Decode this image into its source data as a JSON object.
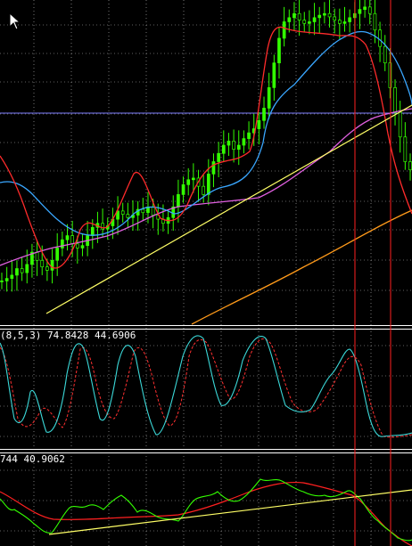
{
  "stochastic_panel": {
    "label": "(8,5,3) 74.8428 44.6906"
  },
  "oscillator_panel": {
    "label": "744 40.9062"
  },
  "cursor": {
    "icon": "mouse-pointer-icon"
  },
  "colors": {
    "background": "#000000",
    "grid": "#c0c0c0",
    "price": "#33ff00",
    "ma_fast": "#ff2b2b",
    "ma_mid": "#3aa7ff",
    "ma_slow": "#e060e0",
    "ma_long": "#ff9a1a",
    "trendline": "#ffff66",
    "hline": "#8080ff",
    "vlines": "#ff1f1f",
    "stoch_main": "#3bd8d8",
    "stoch_signal": "#ff3030",
    "osc_main": "#33ff00",
    "osc_signal": "#ff2020"
  },
  "chart_data": {
    "type": "line",
    "series": [
      {
        "values": [
          5,
          8,
          12,
          20,
          15,
          25,
          40,
          30,
          22,
          18,
          30,
          45,
          55,
          60,
          50,
          45,
          48,
          60,
          70,
          75,
          68,
          72,
          80,
          90,
          86,
          82,
          85,
          92,
          88,
          95,
          85,
          80,
          75,
          82,
          95,
          110,
          122,
          128,
          130,
          120,
          110,
          135,
          150,
          160,
          170,
          175,
          165,
          170,
          178,
          185,
          190,
          200,
          215,
          240,
          270,
          300,
          320,
          325,
          330,
          322,
          318,
          320,
          325,
          328,
          330,
          326,
          322,
          318,
          320,
          325,
          330,
          335,
          338,
          330,
          310,
          290,
          270,
          240,
          210,
          180,
          150,
          140
        ]
      },
      {
        "values": [
          30,
          35,
          42,
          50,
          55,
          60,
          62,
          65,
          68,
          70,
          72,
          75,
          78,
          80,
          80,
          82,
          84,
          86,
          88,
          90,
          93,
          96,
          100,
          105,
          110,
          115,
          120,
          125,
          130,
          135,
          140,
          145,
          150,
          155,
          160,
          165,
          170,
          175,
          180,
          185,
          190,
          195,
          200,
          205,
          212,
          220,
          228,
          235,
          242,
          250,
          258,
          265,
          272,
          280,
          288,
          296,
          304,
          312,
          318,
          325,
          330,
          334,
          338,
          340,
          338,
          334,
          330,
          325,
          320,
          312,
          300,
          290
        ]
      },
      {
        "values": [
          10,
          12,
          14,
          16,
          18,
          20,
          22,
          24,
          26,
          28,
          30,
          33,
          36,
          40,
          44,
          48,
          52,
          56,
          60,
          64,
          68,
          72,
          76,
          80,
          84,
          88,
          92,
          96,
          100,
          104,
          108,
          112,
          116,
          120,
          124,
          128,
          132,
          136,
          140,
          144,
          148,
          152,
          156,
          160,
          164,
          168,
          172,
          176,
          180,
          184,
          188,
          192,
          196,
          200,
          205,
          210,
          215,
          220,
          225,
          230,
          234,
          238,
          240,
          242,
          243,
          244,
          245
        ]
      }
    ]
  }
}
